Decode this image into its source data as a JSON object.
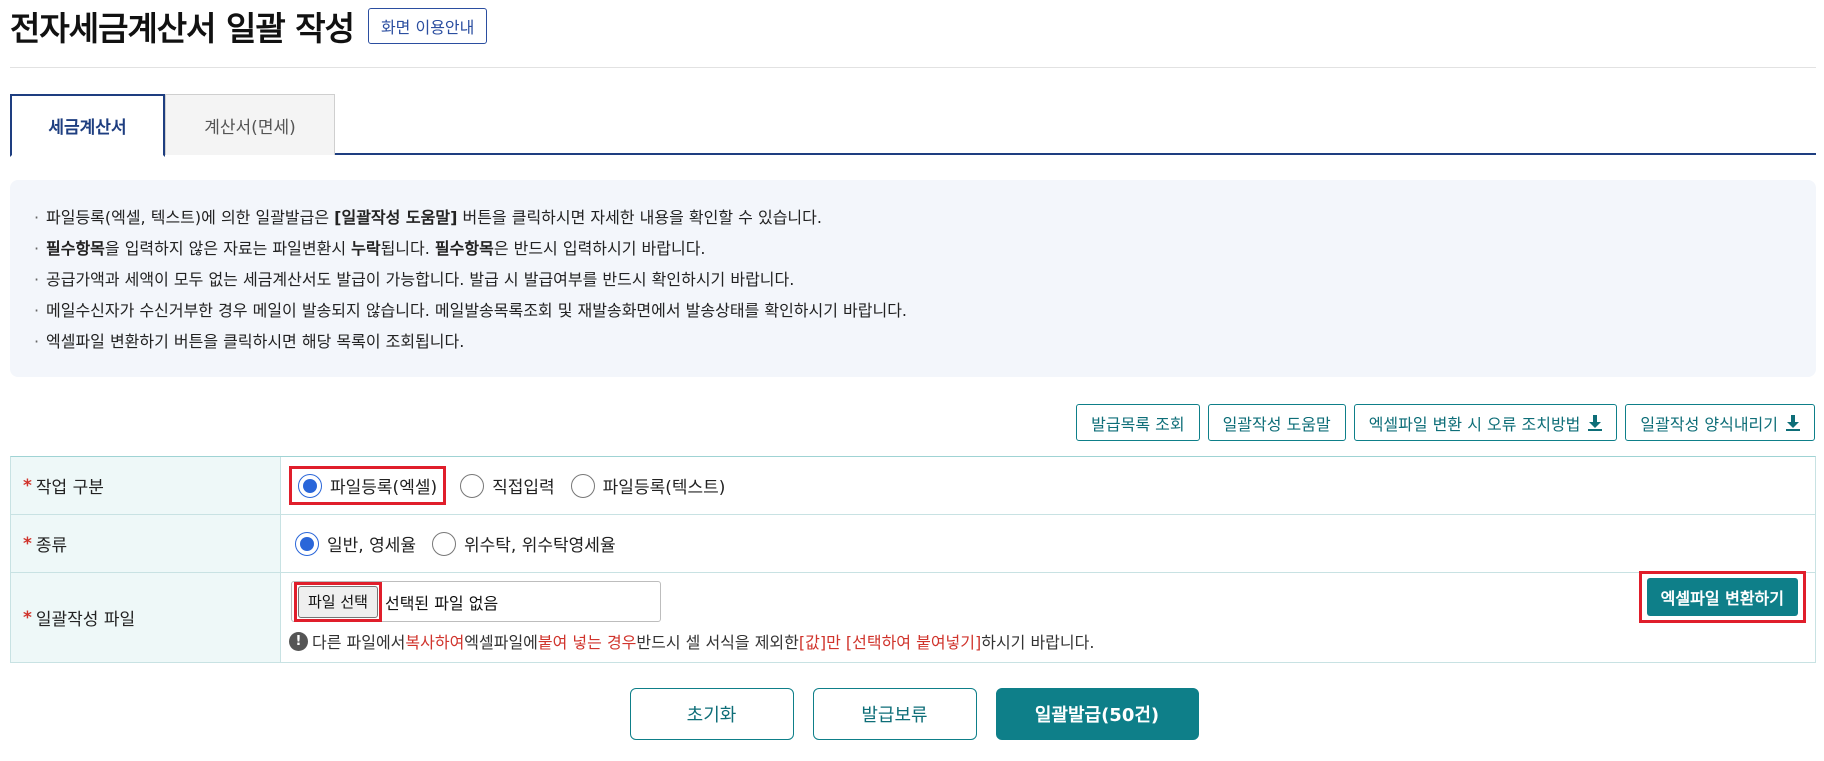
{
  "page": {
    "title": "전자세금계산서 일괄 작성",
    "guide_button": "화면 이용안내"
  },
  "tabs": [
    {
      "label": "세금계산서",
      "active": true
    },
    {
      "label": "계산서(면세)",
      "active": false
    }
  ],
  "notice": {
    "line1_a": "파일등록(엑셀, 텍스트)에 의한 일괄발급은 ",
    "line1_b": "[일괄작성 도움말]",
    "line1_c": " 버튼을 클릭하시면 자세한 내용을 확인할 수 있습니다.",
    "line2_a": "필수항목",
    "line2_b": "을 입력하지 않은 자료는 파일변환시 ",
    "line2_c": "누락",
    "line2_d": "됩니다. ",
    "line2_e": "필수항목",
    "line2_f": "은 반드시 입력하시기 바랍니다.",
    "line3": "공급가액과 세액이 모두 없는 세금계산서도 발급이 가능합니다. 발급 시 발급여부를 반드시 확인하시기 바랍니다.",
    "line4": "메일수신자가 수신거부한 경우 메일이 발송되지 않습니다. 메일발송목록조회 및 재발송화면에서 발송상태를 확인하시기 바랍니다.",
    "line5": "엑셀파일 변환하기 버튼을 클릭하시면 해당 목록이 조회됩니다."
  },
  "actions": {
    "list": "발급목록 조회",
    "help": "일괄작성 도움말",
    "error_guide": "엑셀파일 변환 시 오류 조치방법",
    "template": "일괄작성 양식내리기"
  },
  "form": {
    "work_type": {
      "label": "작업 구분",
      "options": [
        "파일등록(엑셀)",
        "직접입력",
        "파일등록(텍스트)"
      ],
      "selected": "파일등록(엑셀)"
    },
    "kind": {
      "label": "종류",
      "options": [
        "일반, 영세율",
        "위수탁, 위수탁영세율"
      ],
      "selected": "일반, 영세율"
    },
    "file": {
      "label": "일괄작성 파일",
      "button": "파일 선택",
      "status": "선택된 파일 없음",
      "note_1": "다른 파일에서 ",
      "note_2": "복사하여",
      "note_3": " 엑셀파일에 ",
      "note_4": "붙여 넣는 경우",
      "note_5": " 반드시 셀 서식을 제외한 ",
      "note_6": "[값]만 [선택하여 붙여넣기]",
      "note_7": " 하시기 바랍니다.",
      "convert_button": "엑셀파일 변환하기"
    },
    "required_mark": "*"
  },
  "bottom": {
    "reset": "초기화",
    "hold": "발급보류",
    "issue": "일괄발급(50건)"
  },
  "colors": {
    "accent_teal": "#0e7f89",
    "navy": "#1e3e80",
    "highlight_red": "#e01e2b",
    "radio_blue": "#2a66d9"
  }
}
